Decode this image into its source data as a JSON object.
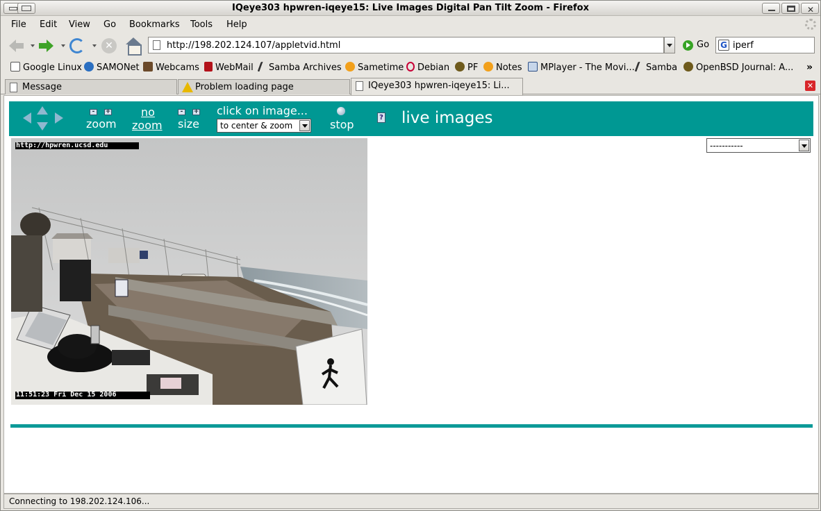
{
  "window": {
    "title": "IQeye303 hpwren-iqeye15: Live Images Digital Pan Tilt Zoom - Firefox"
  },
  "menu": {
    "items": [
      {
        "label": "File"
      },
      {
        "label": "Edit"
      },
      {
        "label": "View"
      },
      {
        "label": "Go"
      },
      {
        "label": "Bookmarks"
      },
      {
        "label": "Tools"
      },
      {
        "label": "Help"
      }
    ]
  },
  "navbar": {
    "url": "http://198.202.124.107/appletvid.html",
    "go_label": "Go",
    "search_value": "iperf"
  },
  "bookmarks": [
    {
      "label": "Google Linux",
      "icon": "google-icon"
    },
    {
      "label": "SAMONet",
      "icon": "drop-icon"
    },
    {
      "label": "Webcams",
      "icon": "shield-icon"
    },
    {
      "label": "WebMail",
      "icon": "yahoo-icon"
    },
    {
      "label": "Samba Archives",
      "icon": "samba-icon"
    },
    {
      "label": "Sametime",
      "icon": "sametime-icon"
    },
    {
      "label": "Debian",
      "icon": "debian-icon"
    },
    {
      "label": "PF",
      "icon": "pufferfish-icon"
    },
    {
      "label": "Notes",
      "icon": "notes-icon"
    },
    {
      "label": "MPlayer - The Movi...",
      "icon": "mplayer-icon"
    },
    {
      "label": "Samba",
      "icon": "samba-icon"
    },
    {
      "label": "OpenBSD Journal: A...",
      "icon": "pufferfish-icon"
    }
  ],
  "tabs": [
    {
      "label": "Message",
      "active": false
    },
    {
      "label": "Problem loading page",
      "active": false
    },
    {
      "label": "IQeye303 hpwren-iqeye15: Li...",
      "active": true
    }
  ],
  "camera_ui": {
    "zoom_label": "zoom",
    "no_zoom_line1": "no",
    "no_zoom_line2": "zoom",
    "size_label": "size",
    "click_label": "click on image...",
    "click_mode": "to center & zoom",
    "stop_label": "stop",
    "help_label": "?",
    "live_label": "live images",
    "preset_select": "-----------",
    "minus": "-",
    "plus": "+"
  },
  "camera_image": {
    "overlay_url": "http://hpwren.ucsd.edu",
    "overlay_timestamp": "11:51:23 Fri Dec 15 2006"
  },
  "status": {
    "text": "Connecting to 198.202.124.106..."
  },
  "colors": {
    "teal": "#009893",
    "accent_rule": "#0c9a98"
  }
}
